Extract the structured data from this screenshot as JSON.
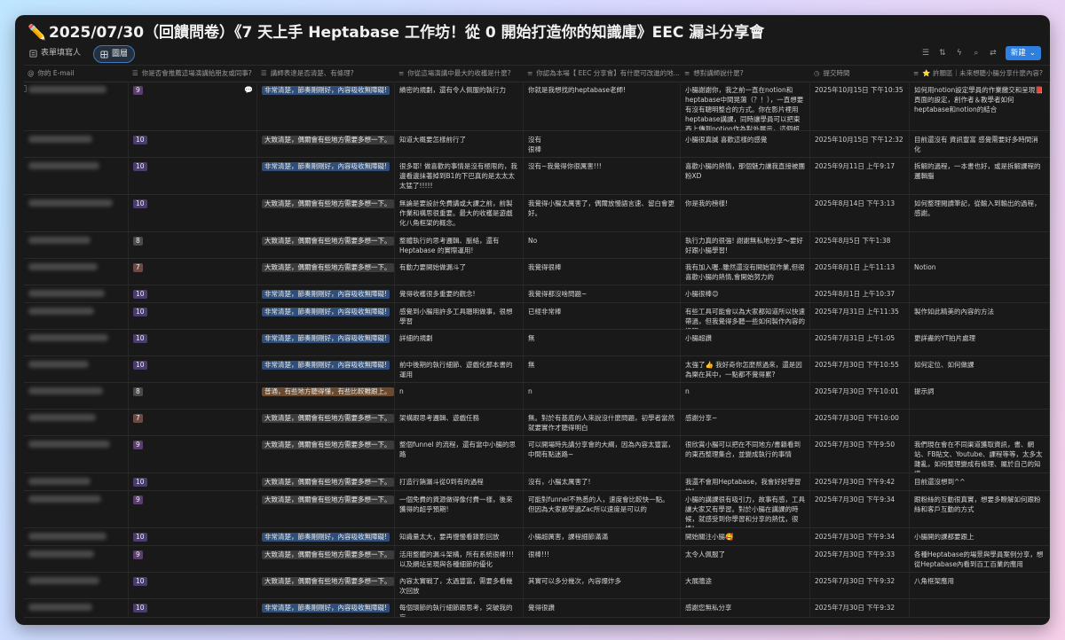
{
  "title_icon": "✏️",
  "title": "2025/07/30（回饋問卷）《7 天上手 Heptabase 工作坊！從 0 開始打造你的知識庫》EEC 漏斗分享會",
  "views": [
    {
      "label": "表單填寫人",
      "icon": "form-icon"
    },
    {
      "label": "圖層",
      "icon": "grid-icon",
      "active": true
    }
  ],
  "toolbar": {
    "new_label": "新建"
  },
  "columns": [
    {
      "key": "email",
      "icon": "@",
      "label": "你的 E-mail"
    },
    {
      "key": "rec",
      "icon": "☰",
      "label": "你是否會推薦這場演講給朋友或同事?"
    },
    {
      "key": "clarity",
      "icon": "☰",
      "label": "講師表達是否清楚、有條理?"
    },
    {
      "key": "gain",
      "icon": "≡",
      "label": "你從這場演講中最大的收穫是什麼?"
    },
    {
      "key": "improve",
      "icon": "≡",
      "label": "你認為本場【 EEC 分享會】有什麼可改進的地..."
    },
    {
      "key": "thanks",
      "icon": "≡",
      "label": "想對講師說什麼?"
    },
    {
      "key": "time",
      "icon": "◷",
      "label": "提交時間"
    },
    {
      "key": "wish",
      "icon": "≡",
      "label": "⭐ 許願區｜未來想聽小腸分享什麼內容?"
    }
  ],
  "score_colors": {
    "9": "#5a3f6e",
    "10": "#4a3d6e",
    "8": "#4a4a4a",
    "7": "#6b4a45"
  },
  "tag_colors": {
    "a": "#2f4f7a",
    "b": "#3b3b3b",
    "c": "#6b4a2e"
  },
  "rows": [
    {
      "rec": "9",
      "clarity": "非常清楚，節奏剛剛好，內容吸收無障礙!",
      "ct": "a",
      "gain": "績密的規劃，還有令人佩服的執行力",
      "improve": "你就是我想找的heptabase老師!",
      "thanks": "小腸謝謝你，我之前一直在notion和heptabase中間晃蕩（？！），一直想要有沒有聰明整合的方式。你在影片裡用heptabase講課，同時讓學員可以把東西上傳到notion作為對外展示，這個超級實用。",
      "time": "2025年10月15日 下午10:35",
      "wish": "如何用notion設定學員的作業繳交和呈現📕頁面的設定，創作者＆教學者如何heptabase和notion的結合",
      "h": 55,
      "comment": true
    },
    {
      "rec": "10",
      "clarity": "大致清楚，偶爾會有些地方需要多想一下。",
      "ct": "b",
      "gain": "知道大概要怎樣前行了",
      "improve": "沒有\n很棒",
      "thanks": "小腸很真誠 喜歡這樣的感覺",
      "time": "2025年10月15日 下午12:32",
      "wish": "目前還沒有 資訊豐富 感覺需要好多時間消化",
      "h": 29
    },
    {
      "rec": "10",
      "clarity": "非常清楚，節奏剛剛好，內容吸收無障礙!",
      "ct": "a",
      "gain": "很多耶! 做喜歡的事情是沒有極限的，我邊看邊抹著掉到B1的下巴真的是太太太太猛了!!!!!",
      "improve": "沒有~我覺得你很厲害!!!",
      "thanks": "喜歡小腸的熱情，那個魅力讓我直接被團粉XD",
      "time": "2025年9月11日 上午9:17",
      "wish": "拆解的過程，一本書也好，或是拆解課程的邏輯腦",
      "h": 41
    },
    {
      "rec": "10",
      "clarity": "大致清楚，偶爾會有些地方需要多想一下。",
      "ct": "b",
      "gain": "無論是要設計免費講或大課之前，前製作業和構思很重要。最大的收穫是遊戲化八角框架的概念。",
      "improve": "我覺得小腸太厲害了，偶爾放慢語言速、留白會更好。",
      "thanks": "你是我的榜樣!",
      "time": "2025年8月14日 下午3:13",
      "wish": "如何整理閱讀筆記，從輸入到輸出的過程，感謝。",
      "h": 41
    },
    {
      "rec": "8",
      "clarity": "大致清楚，偶爾會有些地方需要多想一下。",
      "ct": "b",
      "gain": "整體執行的思考邏輯、脈絡，還有Heptabase 的實際運用!",
      "improve": "No",
      "thanks": "執行力真的很強! 謝謝無私地分享～要好好跟小腸學習!",
      "time": "2025年8月5日 下午1:38",
      "wish": "",
      "h": 29
    },
    {
      "rec": "7",
      "clarity": "大致清楚，偶爾會有些地方需要多想一下。",
      "ct": "b",
      "gain": "有動力要開始做漏斗了",
      "improve": "我覺得很棒",
      "thanks": "我有加入喔..雖然還沒有開始寫作業,但很喜歡小腸的熱情,會開始努力的",
      "time": "2025年8月1日 上午11:13",
      "wish": "Notion",
      "h": 29
    },
    {
      "rec": "10",
      "clarity": "非常清楚，節奏剛剛好，內容吸收無障礙!",
      "ct": "a",
      "gain": "覺得收穫很多重要的觀念!",
      "improve": "我覺得都沒啥問題~",
      "thanks": "小腸很棒😊",
      "time": "2025年8月1日 上午10:37",
      "wish": "",
      "h": 19
    },
    {
      "rec": "10",
      "clarity": "非常清楚，節奏剛剛好，內容吸收無障礙!",
      "ct": "a",
      "gain": "感覺到小腸用許多工具聰明做事，很想學習",
      "improve": "已經非常棒",
      "thanks": "有些工具可能會以為大家都知道所以快速帶過，但我覺得多聽一些如何製作內容的過程",
      "time": "2025年7月31日 上午11:35",
      "wish": "製作如此精美的內容的方法",
      "h": 29
    },
    {
      "rec": "10",
      "clarity": "非常清楚，節奏剛剛好，內容吸收無障礙!",
      "ct": "a",
      "gain": "詳細的規劃",
      "improve": "無",
      "thanks": "小腸超讚",
      "time": "2025年7月31日 上午1:05",
      "wish": "更詳盡的YT拍片處理",
      "h": 29
    },
    {
      "rec": "10",
      "clarity": "非常清楚，節奏剛剛好，內容吸收無障礙!",
      "ct": "a",
      "gain": "前中後期的執行細節、遊戲化那本書的運用",
      "improve": "無",
      "thanks": "太強了👍 我好奇你怎麼熬過來，還是因為樂在其中，一點都不覺得累?",
      "time": "2025年7月30日 下午10:55",
      "wish": "如何定位、如何做課",
      "h": 29
    },
    {
      "rec": "8",
      "clarity": "普通，有些地方聽得懂，有些比較難跟上。",
      "ct": "c",
      "gain": "n",
      "improve": "n",
      "thanks": "n",
      "time": "2025年7月30日 下午10:01",
      "wish": "提示詞",
      "h": 29
    },
    {
      "rec": "7",
      "clarity": "大致清楚，偶爾會有些地方需要多想一下。",
      "ct": "b",
      "gain": "架構跟思考邏輯、遊戲任務",
      "improve": "無。對於有基底的人來說沒什麼問題，初學者當然就要實作才聽得明白",
      "thanks": "感謝分享~",
      "time": "2025年7月30日 下午10:00",
      "wish": "",
      "h": 29
    },
    {
      "rec": "9",
      "clarity": "大致清楚，偶爾會有些地方需要多想一下。",
      "ct": "b",
      "gain": "整個funnel 的流程，還有當中小腸的思路",
      "improve": "可以開場時先講分享會的大綱，因為內容太豐富，中間有點迷路~",
      "thanks": "很欣賞小腸可以把在不同地方/書籍看到的東西整理集合，並變成執行的事情",
      "time": "2025年7月30日 下午9:50",
      "wish": "我們現在會在不同渠道獲取資訊，書、網站、FB貼文、Youtube、課程等等，太多太雜亂，如何整理變成有條理、屬於自己的知識",
      "h": 41
    },
    {
      "rec": "10",
      "clarity": "大致清楚，偶爾會有些地方需要多想一下。",
      "ct": "b",
      "gain": "打造行銷漏斗從0到有的過程",
      "improve": "沒有，小腸太厲害了!",
      "thanks": "我還不會用Heptabase，我會好好學習的!",
      "time": "2025年7月30日 下午9:42",
      "wish": "目前還沒想到^^",
      "h": 19
    },
    {
      "rec": "9",
      "clarity": "大致清楚，偶爾會有些地方需要多想一下。",
      "ct": "b",
      "gain": "一個免費的資源做得像付費一樣，後來獲得的超乎預期!",
      "improve": "可能對funnel不熟悉的人，速度會比較快一點。但因為大家都學過Zac所以速度是可以的",
      "thanks": "小腸的講課很有吸引力，故事有感，工具讓大家又有學習。對於小腸在講課的時候，就感受到你學習和分享的熱忱，很棒!",
      "time": "2025年7月30日 下午9:34",
      "wish": "跟粉絲的互動很真實，想要多瞭解如何跟粉絲和客戶互動的方式",
      "h": 41
    },
    {
      "rec": "10",
      "clarity": "非常清楚，節奏剛剛好，內容吸收無障礙!",
      "ct": "a",
      "gain": "知識量太大，要再慢慢看錄影回放",
      "improve": "小腸超厲害，課程細節滿滿",
      "thanks": "開始關注小腸🥰",
      "time": "2025年7月30日 下午9:34",
      "wish": "小腸開的課都要跟上",
      "h": 19
    },
    {
      "rec": "9",
      "clarity": "大致清楚，偶爾會有些地方需要多想一下。",
      "ct": "b",
      "gain": "活用整體的漏斗架構，所有系統很棒!!! 以及網站呈現與各種細節的優化",
      "improve": "很棒!!!",
      "thanks": "太令人佩服了",
      "time": "2025年7月30日 下午9:33",
      "wish": "各種Heptabase的場景與學員案例分享，想從Heptabase內看到百工百業的應用",
      "h": 29
    },
    {
      "rec": "10",
      "clarity": "大致清楚，偶爾會有些地方需要多想一下。",
      "ct": "b",
      "gain": "內容太實戰了，太過豐富，需要多看幾次回放",
      "improve": "其實可以多分幾次，內容爆炸多",
      "thanks": "大展牆途",
      "time": "2025年7月30日 下午9:32",
      "wish": "八角框架應用",
      "h": 29
    },
    {
      "rec": "10",
      "clarity": "非常清楚，節奏剛剛好，內容吸收無障礙!",
      "ct": "a",
      "gain": "每個環節的執行細節跟思考，突破我的盲",
      "improve": "覺得很讚",
      "thanks": "感謝您無私分享",
      "time": "2025年7月30日 下午9:32",
      "wish": "",
      "h": 20
    }
  ]
}
